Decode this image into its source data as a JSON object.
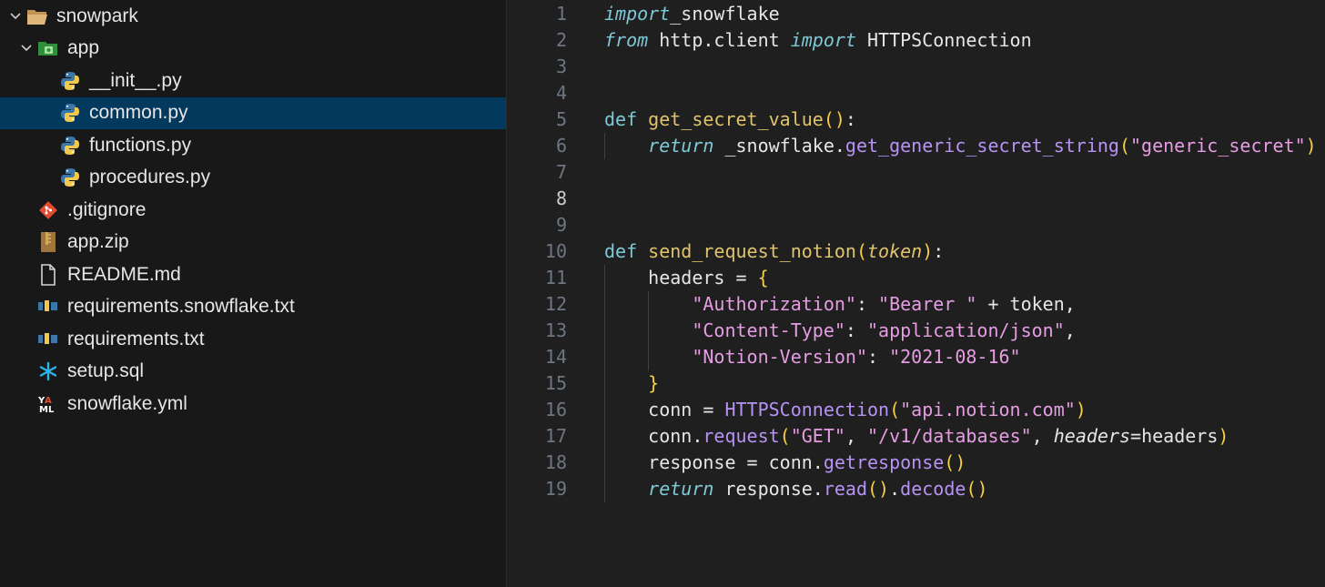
{
  "explorer": {
    "items": [
      {
        "label": "snowpark",
        "icon": "folder-open-icon",
        "depth": 0,
        "chevron": "expanded"
      },
      {
        "label": "app",
        "icon": "folder-app-icon",
        "depth": 1,
        "chevron": "expanded"
      },
      {
        "label": "__init__.py",
        "icon": "python-icon",
        "depth": 2
      },
      {
        "label": "common.py",
        "icon": "python-icon",
        "depth": 2,
        "selected": true
      },
      {
        "label": "functions.py",
        "icon": "python-icon",
        "depth": 2
      },
      {
        "label": "procedures.py",
        "icon": "python-icon",
        "depth": 2
      },
      {
        "label": ".gitignore",
        "icon": "git-icon",
        "depth": 1
      },
      {
        "label": "app.zip",
        "icon": "zip-icon",
        "depth": 1
      },
      {
        "label": "README.md",
        "icon": "file-icon",
        "depth": 1
      },
      {
        "label": "requirements.snowflake.txt",
        "icon": "pip-icon",
        "depth": 1
      },
      {
        "label": "requirements.txt",
        "icon": "pip-icon",
        "depth": 1
      },
      {
        "label": "setup.sql",
        "icon": "snowflake-icon",
        "depth": 1
      },
      {
        "label": "snowflake.yml",
        "icon": "yaml-icon",
        "depth": 1
      }
    ]
  },
  "editor": {
    "active_line": 8,
    "lines": [
      {
        "n": "1",
        "tokens": [
          [
            "kwi",
            "import"
          ],
          [
            "",
            "_snowflake"
          ]
        ]
      },
      {
        "n": "2",
        "tokens": [
          [
            "kwi",
            "from"
          ],
          [
            "",
            " http.client "
          ],
          [
            "kwi",
            "import"
          ],
          [
            "",
            " HTTPSConnection"
          ]
        ]
      },
      {
        "n": "3",
        "tokens": []
      },
      {
        "n": "4",
        "tokens": []
      },
      {
        "n": "5",
        "tokens": [
          [
            "kw",
            "def"
          ],
          [
            "",
            ""
          ],
          [
            "fn",
            "get_secret_value"
          ],
          [
            "par",
            "()"
          ],
          [
            "",
            ":"
          ]
        ]
      },
      {
        "n": "6",
        "tokens": [
          [
            "",
            "    "
          ],
          [
            "kwi",
            "return"
          ],
          [
            "",
            " _snowflake."
          ],
          [
            "meth",
            "get_generic_secret_string"
          ],
          [
            "par",
            "("
          ],
          [
            "str",
            "\"generic_secret\""
          ],
          [
            "par",
            ")"
          ]
        ]
      },
      {
        "n": "7",
        "tokens": []
      },
      {
        "n": "8",
        "tokens": []
      },
      {
        "n": "9",
        "tokens": []
      },
      {
        "n": "10",
        "tokens": [
          [
            "kw",
            "def"
          ],
          [
            "",
            " "
          ],
          [
            "fn",
            "send_request_notion"
          ],
          [
            "par",
            "("
          ],
          [
            "param",
            "token"
          ],
          [
            "par",
            ")"
          ],
          [
            "",
            ":"
          ]
        ]
      },
      {
        "n": "11",
        "tokens": [
          [
            "",
            "    headers = "
          ],
          [
            "par",
            "{"
          ]
        ]
      },
      {
        "n": "12",
        "tokens": [
          [
            "",
            "        "
          ],
          [
            "str",
            "\"Authorization\""
          ],
          [
            "",
            ": "
          ],
          [
            "str",
            "\"Bearer \""
          ],
          [
            "",
            " + token,"
          ]
        ]
      },
      {
        "n": "13",
        "tokens": [
          [
            "",
            "        "
          ],
          [
            "str",
            "\"Content-Type\""
          ],
          [
            "",
            ": "
          ],
          [
            "str",
            "\"application/json\""
          ],
          [
            "",
            ","
          ]
        ]
      },
      {
        "n": "14",
        "tokens": [
          [
            "",
            "        "
          ],
          [
            "str",
            "\"Notion-Version\""
          ],
          [
            "",
            ": "
          ],
          [
            "str",
            "\"2021-08-16\""
          ]
        ]
      },
      {
        "n": "15",
        "tokens": [
          [
            "",
            "    "
          ],
          [
            "par",
            "}"
          ]
        ]
      },
      {
        "n": "16",
        "tokens": [
          [
            "",
            "    conn = "
          ],
          [
            "cls",
            "HTTPSConnection"
          ],
          [
            "par",
            "("
          ],
          [
            "str",
            "\"api.notion.com\""
          ],
          [
            "par",
            ")"
          ]
        ]
      },
      {
        "n": "17",
        "tokens": [
          [
            "",
            "    conn."
          ],
          [
            "meth",
            "request"
          ],
          [
            "par",
            "("
          ],
          [
            "str",
            "\"GET\""
          ],
          [
            "",
            ", "
          ],
          [
            "str",
            "\"/v1/databases\""
          ],
          [
            "",
            ", "
          ],
          [
            "kwarg",
            "headers"
          ],
          [
            "",
            "=headers"
          ],
          [
            "par",
            ")"
          ]
        ]
      },
      {
        "n": "18",
        "tokens": [
          [
            "",
            "    response = conn."
          ],
          [
            "meth",
            "getresponse"
          ],
          [
            "par",
            "()"
          ]
        ]
      },
      {
        "n": "19",
        "tokens": [
          [
            "",
            "    "
          ],
          [
            "kwi",
            "return"
          ],
          [
            "",
            " response."
          ],
          [
            "meth",
            "read"
          ],
          [
            "par",
            "()"
          ],
          [
            "",
            "."
          ],
          [
            "meth",
            "decode"
          ],
          [
            "par",
            "()"
          ]
        ]
      }
    ]
  },
  "colors": {
    "sidebar_bg": "#181818",
    "editor_bg": "#1f1f1f",
    "selection": "#04395e"
  }
}
